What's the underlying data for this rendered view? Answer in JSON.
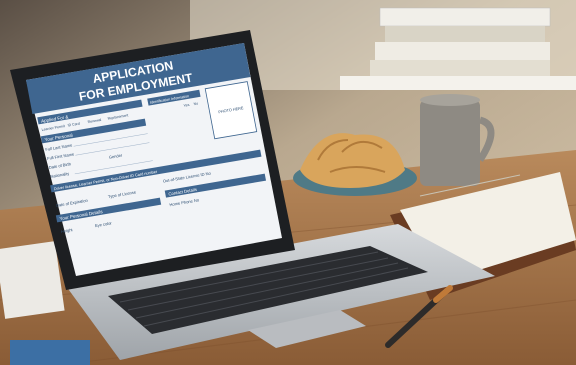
{
  "form": {
    "title_line1": "APPLICATION",
    "title_line2": "FOR  EMPLOYMENT",
    "applied_for_label": "Applied For &",
    "applied_for_options": [
      "Learner Permit",
      "ID Card",
      "Renewal",
      "Replacement"
    ],
    "identification_header": "Identification Information",
    "photo_label": "PHOTO HERE",
    "yes_label": "Yes",
    "no_label": "No",
    "personal_header": "Your Personal",
    "full_last_name": "Full Last Name",
    "full_first_name": "Full First Name",
    "date_of_birth": "Date of Birth",
    "gender": "Gender",
    "nationality": "Nationality",
    "driver_license_header": "Driver license, Learner Permit, or Non-Driver ID Card number",
    "date_of_expiration": "Date of Expiration",
    "type_of_license": "Type of License",
    "out_of_state": "Out-of-State License ID No",
    "contact_details": "Contact Details",
    "home_phone": "Home Phone No",
    "personal_details": "Your Personal Details",
    "height": "Height",
    "eye_color": "Eye color"
  },
  "colors": {
    "form_header": "#3f6690",
    "form_text": "#2e4f73",
    "screen_bg": "#f2f4f7"
  }
}
